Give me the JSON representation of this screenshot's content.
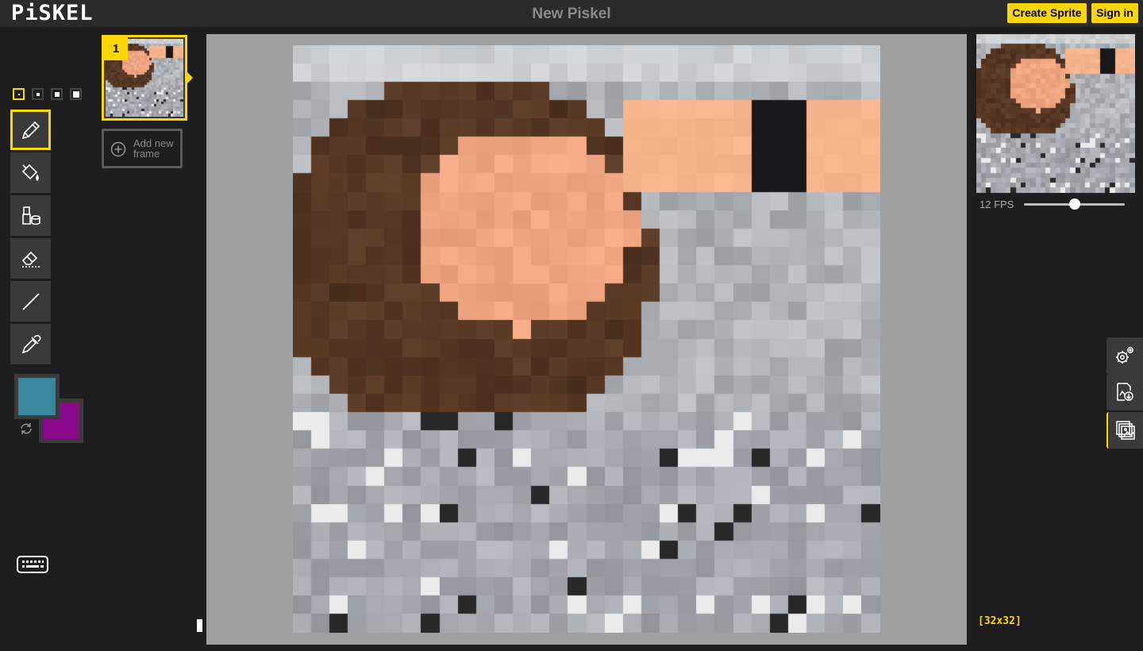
{
  "header": {
    "logo": "PiSKEL",
    "title": "New Piskel",
    "create_label": "Create Sprite",
    "signin_label": "Sign in"
  },
  "tools": {
    "pen_sizes": [
      1,
      2,
      3,
      4
    ],
    "selected_pen_size": 1,
    "items": [
      "pen-tool",
      "paint-bucket-tool",
      "paint-all-same-color-tool",
      "eraser-tool",
      "stroke-tool",
      "color-picker-tool"
    ],
    "selected": "pen-tool"
  },
  "colors": {
    "primary": "#3a87a0",
    "secondary": "#8b0a8c"
  },
  "frames": {
    "items": [
      {
        "number": "1"
      }
    ],
    "add_label": "Add new frame"
  },
  "preview": {
    "fps_label": "12 FPS",
    "fps": 12,
    "fps_max": 24
  },
  "canvas": {
    "size_label": "[32x32]"
  },
  "side_panel": [
    "settings-icon",
    "export-icon",
    "import-icon"
  ],
  "theme": {
    "accent": "#ffd700",
    "canvas_bg": "#a0a0a0"
  }
}
